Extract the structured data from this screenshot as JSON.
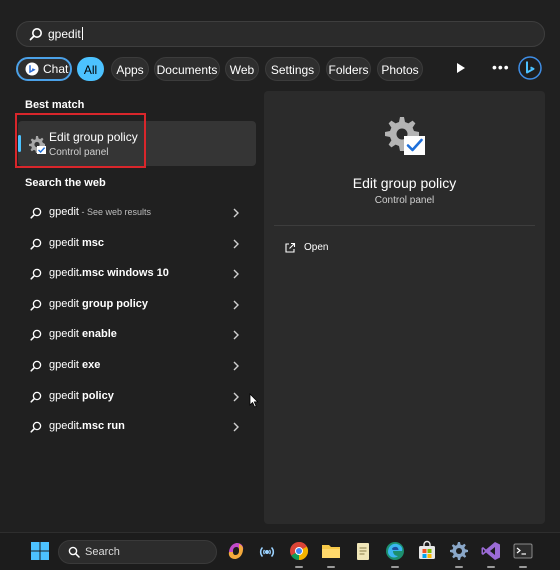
{
  "search": {
    "query": "gpedit"
  },
  "filters": {
    "chat": "Chat",
    "pills": [
      "All",
      "Apps",
      "Documents",
      "Web",
      "Settings",
      "Folders",
      "Photos"
    ],
    "more": "•••"
  },
  "best_match": {
    "heading": "Best match",
    "title": "Edit group policy",
    "subtitle": "Control panel"
  },
  "web": {
    "heading": "Search the web",
    "items": [
      {
        "prefix": "gpedit",
        "bold": "",
        "suffix": " - See web results"
      },
      {
        "prefix": "gpedit ",
        "bold": "msc",
        "suffix": ""
      },
      {
        "prefix": "gpedit",
        "bold": ".msc windows 10",
        "suffix": ""
      },
      {
        "prefix": "gpedit ",
        "bold": "group policy",
        "suffix": ""
      },
      {
        "prefix": "gpedit ",
        "bold": "enable",
        "suffix": ""
      },
      {
        "prefix": "gpedit ",
        "bold": "exe",
        "suffix": ""
      },
      {
        "prefix": "gpedit ",
        "bold": "policy",
        "suffix": ""
      },
      {
        "prefix": "gpedit",
        "bold": ".msc run",
        "suffix": ""
      }
    ]
  },
  "detail": {
    "title": "Edit group policy",
    "subtitle": "Control panel",
    "actions": [
      {
        "label": "Open",
        "icon": "open-external-icon"
      }
    ]
  },
  "taskbar": {
    "search_label": "Search",
    "apps": [
      "start-icon",
      "copilot-icon",
      "widgets-icon",
      "chrome-icon",
      "file-explorer-icon",
      "notepad-icon",
      "edge-icon",
      "store-icon",
      "settings-icon",
      "visual-studio-icon",
      "terminal-icon"
    ]
  },
  "colors": {
    "accent": "#4cc2ff",
    "highlight_box": "#d9262b",
    "panel": "#202020",
    "detail_bg": "#2b2b2b"
  }
}
